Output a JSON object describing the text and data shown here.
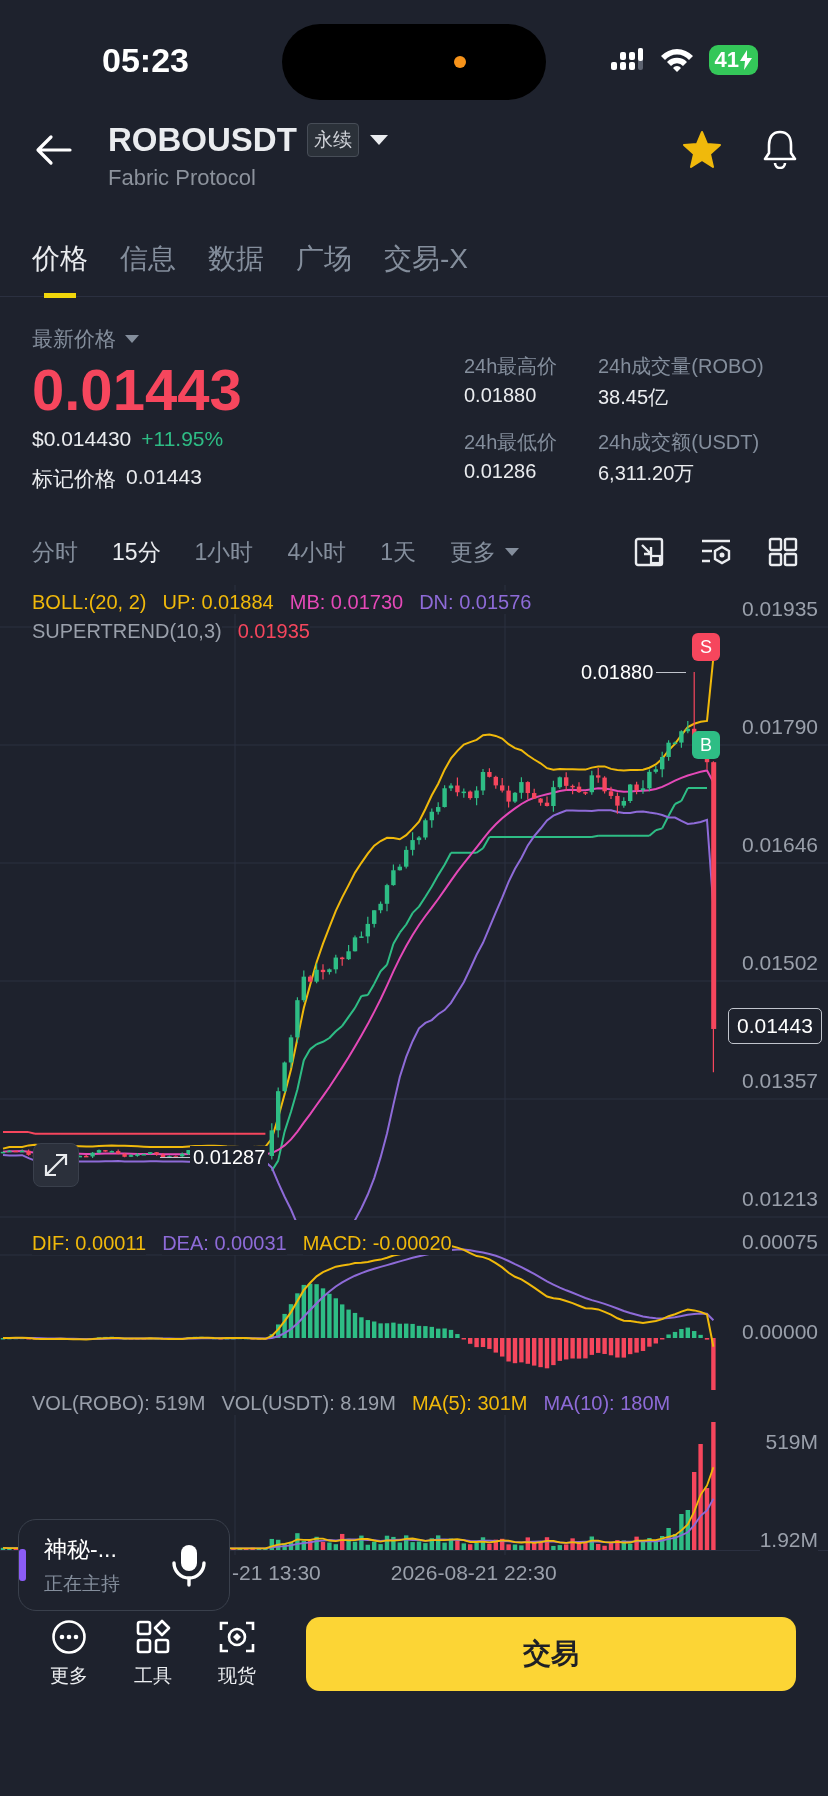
{
  "status_bar": {
    "time": "05:23",
    "battery": "41"
  },
  "header": {
    "symbol": "ROBOUSDT",
    "contract_tag": "永续",
    "subtitle": "Fabric Protocol",
    "favorite": true
  },
  "tabs": [
    {
      "label": "价格",
      "selected": true
    },
    {
      "label": "信息",
      "selected": false
    },
    {
      "label": "数据",
      "selected": false
    },
    {
      "label": "广场",
      "selected": false
    },
    {
      "label": "交易-X",
      "selected": false
    }
  ],
  "price": {
    "label": "最新价格",
    "last": "0.01443",
    "usd": "$0.014430",
    "change": "+11.95%",
    "mark_label": "标记价格",
    "mark": "0.01443"
  },
  "stats": [
    {
      "label": "24h最高价",
      "value": "0.01880"
    },
    {
      "label": "24h成交量(ROBO)",
      "value": "38.45亿"
    },
    {
      "label": "24h最低价",
      "value": "0.01286"
    },
    {
      "label": "24h成交额(USDT)",
      "value": "6,311.20万"
    }
  ],
  "intervals": [
    {
      "label": "分时",
      "selected": false,
      "kind": "option"
    },
    {
      "label": "15分",
      "selected": true,
      "kind": "option"
    },
    {
      "label": "1小时",
      "selected": false,
      "kind": "option"
    },
    {
      "label": "4小时",
      "selected": false,
      "kind": "option"
    },
    {
      "label": "1天",
      "selected": false,
      "kind": "option"
    },
    {
      "label": "更多",
      "selected": false,
      "kind": "dropdown"
    }
  ],
  "chart": {
    "legend": [
      [
        {
          "text": "BOLL:(20, 2)",
          "color": "#f0b90b"
        },
        {
          "text": "UP: 0.01884",
          "color": "#f0b90b"
        },
        {
          "text": "MB: 0.01730",
          "color": "#e449b8"
        },
        {
          "text": "DN: 0.01576",
          "color": "#8e6bd8"
        }
      ],
      [
        {
          "text": "SUPERTREND(10,3)",
          "color": "#9aa0ab"
        },
        {
          "text": "0.01935",
          "color": "#f6465d"
        }
      ]
    ],
    "y_axis": [
      "0.01935",
      "0.01790",
      "0.01646",
      "0.01502",
      "0.01357",
      "0.01213"
    ],
    "high_marker": "0.01880",
    "low_marker": "0.01287",
    "last_price": "0.01443",
    "signals": [
      {
        "label": "S",
        "kind": "sell"
      },
      {
        "label": "B",
        "kind": "buy"
      }
    ]
  },
  "macd": {
    "legend": [
      {
        "text": "DIF: 0.00011",
        "color": "#f0b90b"
      },
      {
        "text": "DEA: 0.00031",
        "color": "#8e6bd8"
      },
      {
        "text": "MACD: -0.00020",
        "color": "#f0b90b"
      }
    ],
    "y_axis": [
      "0.00075",
      "0.00000"
    ]
  },
  "volume": {
    "legend": [
      {
        "text": "VOL(ROBO): 519M",
        "color": "#9aa0ab"
      },
      {
        "text": "VOL(USDT): 8.19M",
        "color": "#9aa0ab"
      },
      {
        "text": "MA(5): 301M",
        "color": "#f0b90b"
      },
      {
        "text": "MA(10): 180M",
        "color": "#8e6bd8"
      }
    ],
    "y_axis": [
      "519M",
      "1.92M"
    ]
  },
  "time_axis": [
    "-21 13:30",
    "2026-08-21 22:30"
  ],
  "live_pill": {
    "title": "神秘-...",
    "subtitle": "正在主持"
  },
  "bottom_bar": {
    "actions": [
      {
        "label": "更多",
        "kind": "more"
      },
      {
        "label": "工具",
        "kind": "tools"
      },
      {
        "label": "现货",
        "kind": "spot"
      }
    ],
    "trade_button": "交易"
  }
}
